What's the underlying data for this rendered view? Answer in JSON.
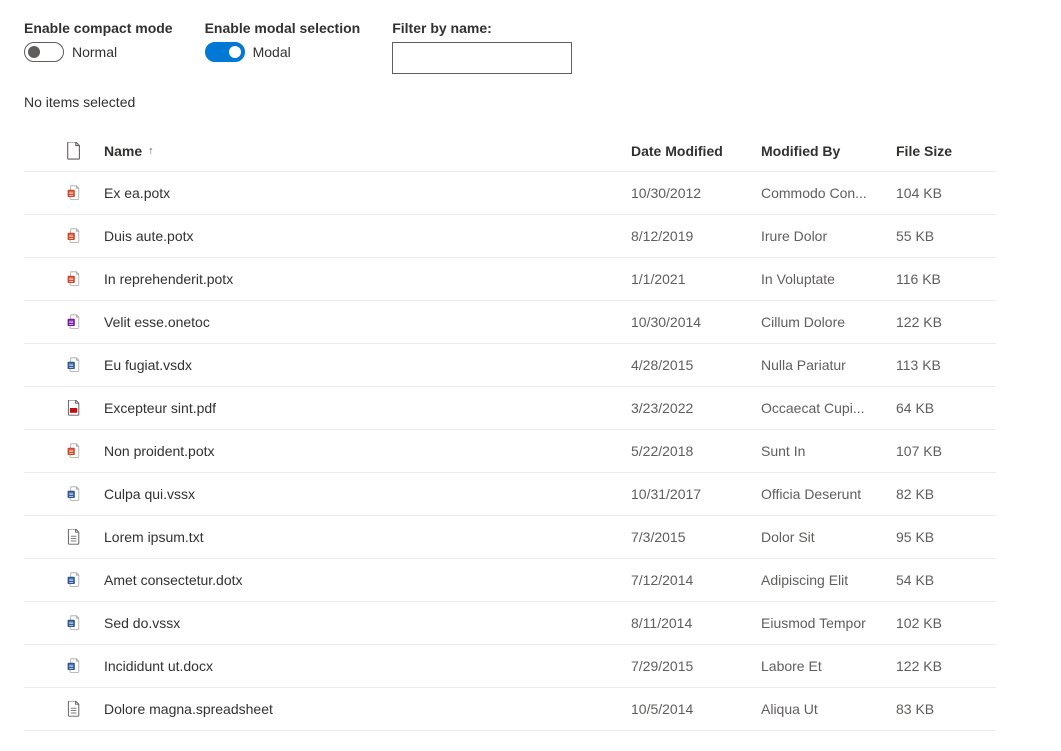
{
  "controls": {
    "compact": {
      "label": "Enable compact mode",
      "state_text": "Normal",
      "on": false
    },
    "modal": {
      "label": "Enable modal selection",
      "state_text": "Modal",
      "on": true
    },
    "filter": {
      "label": "Filter by name:",
      "value": ""
    }
  },
  "status": "No items selected",
  "columns": {
    "name": "Name",
    "date": "Date Modified",
    "modby": "Modified By",
    "size": "File Size",
    "sort_indicator": "↑"
  },
  "rows": [
    {
      "icon": "potx",
      "name": "Ex ea.potx",
      "date": "10/30/2012",
      "modby": "Commodo Con...",
      "size": "104 KB"
    },
    {
      "icon": "potx",
      "name": "Duis aute.potx",
      "date": "8/12/2019",
      "modby": "Irure Dolor",
      "size": "55 KB"
    },
    {
      "icon": "potx",
      "name": "In reprehenderit.potx",
      "date": "1/1/2021",
      "modby": "In Voluptate",
      "size": "116 KB"
    },
    {
      "icon": "onetoc",
      "name": "Velit esse.onetoc",
      "date": "10/30/2014",
      "modby": "Cillum Dolore",
      "size": "122 KB"
    },
    {
      "icon": "vsdx",
      "name": "Eu fugiat.vsdx",
      "date": "4/28/2015",
      "modby": "Nulla Pariatur",
      "size": "113 KB"
    },
    {
      "icon": "pdf",
      "name": "Excepteur sint.pdf",
      "date": "3/23/2022",
      "modby": "Occaecat Cupi...",
      "size": "64 KB"
    },
    {
      "icon": "potx",
      "name": "Non proident.potx",
      "date": "5/22/2018",
      "modby": "Sunt In",
      "size": "107 KB"
    },
    {
      "icon": "vssx",
      "name": "Culpa qui.vssx",
      "date": "10/31/2017",
      "modby": "Officia Deserunt",
      "size": "82 KB"
    },
    {
      "icon": "txt",
      "name": "Lorem ipsum.txt",
      "date": "7/3/2015",
      "modby": "Dolor Sit",
      "size": "95 KB"
    },
    {
      "icon": "dotx",
      "name": "Amet consectetur.dotx",
      "date": "7/12/2014",
      "modby": "Adipiscing Elit",
      "size": "54 KB"
    },
    {
      "icon": "vssx",
      "name": "Sed do.vssx",
      "date": "8/11/2014",
      "modby": "Eiusmod Tempor",
      "size": "102 KB"
    },
    {
      "icon": "docx",
      "name": "Incididunt ut.docx",
      "date": "7/29/2015",
      "modby": "Labore Et",
      "size": "122 KB"
    },
    {
      "icon": "spreadsheet",
      "name": "Dolore magna.spreadsheet",
      "date": "10/5/2014",
      "modby": "Aliqua Ut",
      "size": "83 KB"
    }
  ],
  "icon_colors": {
    "potx": "#d24726",
    "onetoc": "#7719aa",
    "vsdx": "#2b579a",
    "pdf": "#c30b15",
    "vssx": "#2b579a",
    "txt": "#605e5c",
    "dotx": "#2b579a",
    "docx": "#2b579a",
    "spreadsheet": "#605e5c"
  }
}
